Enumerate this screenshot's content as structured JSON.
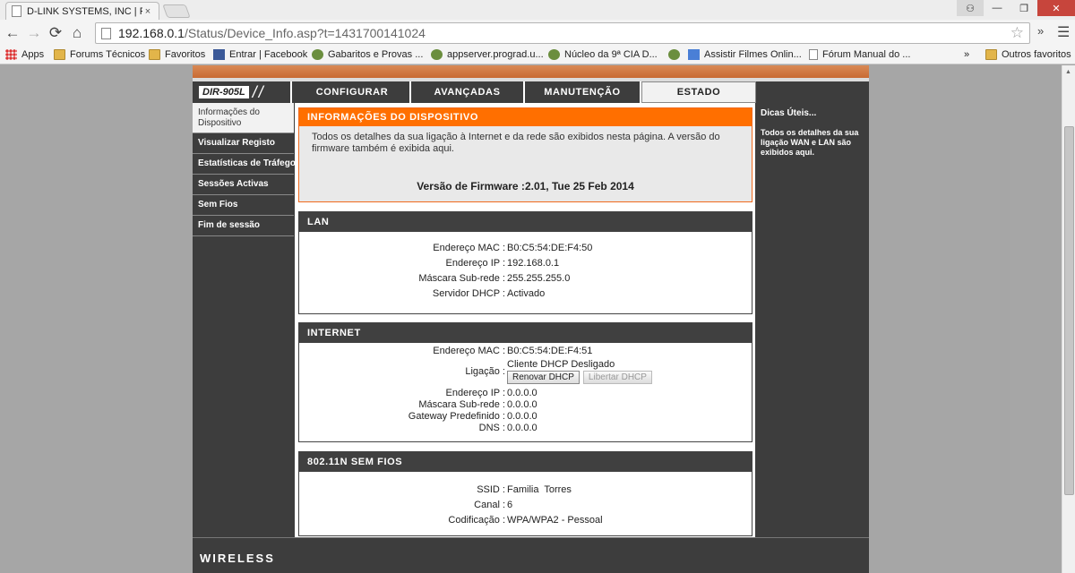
{
  "browser": {
    "tab_title": "D-LINK SYSTEMS, INC | R(",
    "tab_close": "×",
    "user_icon": "user-icon",
    "url_host": "192.168.0.1",
    "url_path": "/Status/Device_Info.asp?t=1431700141024",
    "extensions_glyph": "»",
    "bookmarks_more": "»",
    "bookmarks": [
      {
        "label": "Apps",
        "icon": "apps-icon"
      },
      {
        "label": "Forums Técnicos",
        "icon": "folder-icon"
      },
      {
        "label": "Favoritos",
        "icon": "folder-icon"
      },
      {
        "label": "Entrar | Facebook",
        "icon": "facebook-icon"
      },
      {
        "label": "Gabaritos e Provas ...",
        "icon": "site-icon"
      },
      {
        "label": "appserver.prograd.u...",
        "icon": "site-icon"
      },
      {
        "label": "Núcleo da 9ª CIA D...",
        "icon": "site-icon"
      },
      {
        "label": "Assistir Filmes Onlin...",
        "icon": "google-icon"
      },
      {
        "label": "Fórum Manual do ...",
        "icon": "page-icon"
      },
      {
        "label": "Outros favoritos",
        "icon": "folder-icon"
      }
    ]
  },
  "router": {
    "model": "DIR-905L",
    "tabs": [
      "CONFIGURAR",
      "AVANÇADAS",
      "MANUTENÇÃO",
      "ESTADO"
    ],
    "active_tab": "ESTADO",
    "sidebar": [
      "Informações do Dispositivo",
      "Visualizar Registo",
      "Estatísticas de Tráfego",
      "Sessões Activas",
      "Sem Fios",
      "Fim de sessão"
    ],
    "device_info": {
      "title": "INFORMAÇÕES DO DISPOSITIVO",
      "intro": "Todos os detalhes da sua ligação à Internet e da rede são exibidos nesta página. A versão do firmware também é exibida aqui.",
      "firmware_label": "Versão de Firmware :",
      "firmware_value": "2.01,  Tue 25 Feb 2014"
    },
    "lan": {
      "title": "LAN",
      "mac_label": "Endereço MAC :",
      "mac": "B0:C5:54:DE:F4:50",
      "ip_label": "Endereço IP :",
      "ip": "192.168.0.1",
      "mask_label": "Máscara Sub-rede :",
      "mask": "255.255.255.0",
      "dhcp_label": "Servidor DHCP :",
      "dhcp": "Activado"
    },
    "internet": {
      "title": "INTERNET",
      "mac_label": "Endereço MAC :",
      "mac": "B0:C5:54:DE:F4:51",
      "conn_label": "Ligação :",
      "conn": "Cliente DHCP Desligado",
      "renew_btn": "Renovar DHCP",
      "release_btn": "Libertar DHCP",
      "ip_label": "Endereço IP :",
      "ip": "0.0.0.0",
      "mask_label": "Máscara Sub-rede :",
      "mask": "0.0.0.0",
      "gw_label": "Gateway Predefinido :",
      "gw": "0.0.0.0",
      "dns_label": "DNS :",
      "dns": "0.0.0.0"
    },
    "wireless": {
      "title": "802.11N SEM FIOS",
      "ssid_label": "SSID :",
      "ssid": "Familia  Torres",
      "channel_label": "Canal :",
      "channel": "6",
      "enc_label": "Codificação :",
      "enc": "WPA/WPA2 - Pessoal"
    },
    "hints": {
      "title": "Dicas Úteis...",
      "text": "Todos os detalhes da sua ligação WAN e LAN são exibidos aqui."
    },
    "footer": "WIRELESS",
    "colors": {
      "accent": "#ff6f00",
      "dark": "#3d3d3d"
    }
  }
}
